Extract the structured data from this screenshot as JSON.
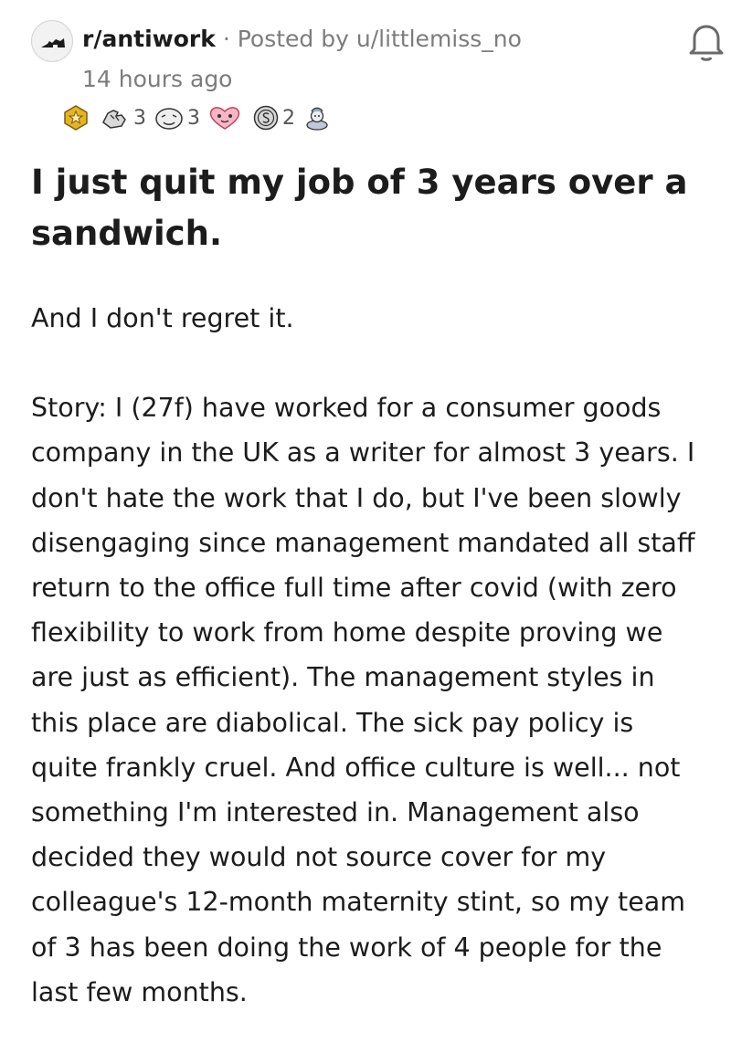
{
  "post": {
    "subreddit": "r/antiwork",
    "separator": "·",
    "posted_by": "Posted by u/littlemiss_no",
    "age": "14 hours ago",
    "title": "I just quit my job of 3 years over a sandwich.",
    "paragraphs": [
      "And I don't regret it.",
      "Story: I (27f) have worked for a consumer goods company in the UK as a writer for almost 3 years. I don't hate the work that I do, but I've been slowly disengaging since management mandated all staff return to the office full time after covid (with zero flexibility to work from home despite proving we are just as efficient). The management styles in this place are diabolical. The sick pay policy is quite frankly cruel. And office culture is well... not something I'm interested in. Management also decided they would not source cover for my colleague's 12-month maternity stint, so my team of 3 has been doing the work of 4 people for the last few months."
    ]
  },
  "awards": [
    {
      "icon": "gold-star-award-icon",
      "count": ""
    },
    {
      "icon": "hands-award-icon",
      "count": "3"
    },
    {
      "icon": "face-award-icon",
      "count": "3"
    },
    {
      "icon": "heart-eyes-award-icon",
      "count": ""
    },
    {
      "icon": "silver-coin-award-icon",
      "count": "2"
    },
    {
      "icon": "genie-award-icon",
      "count": ""
    }
  ],
  "colors": {
    "text": "#1c1c1c",
    "meta": "#7c7c7c",
    "gold": "#e6b422",
    "heart": "#f06a8a"
  }
}
